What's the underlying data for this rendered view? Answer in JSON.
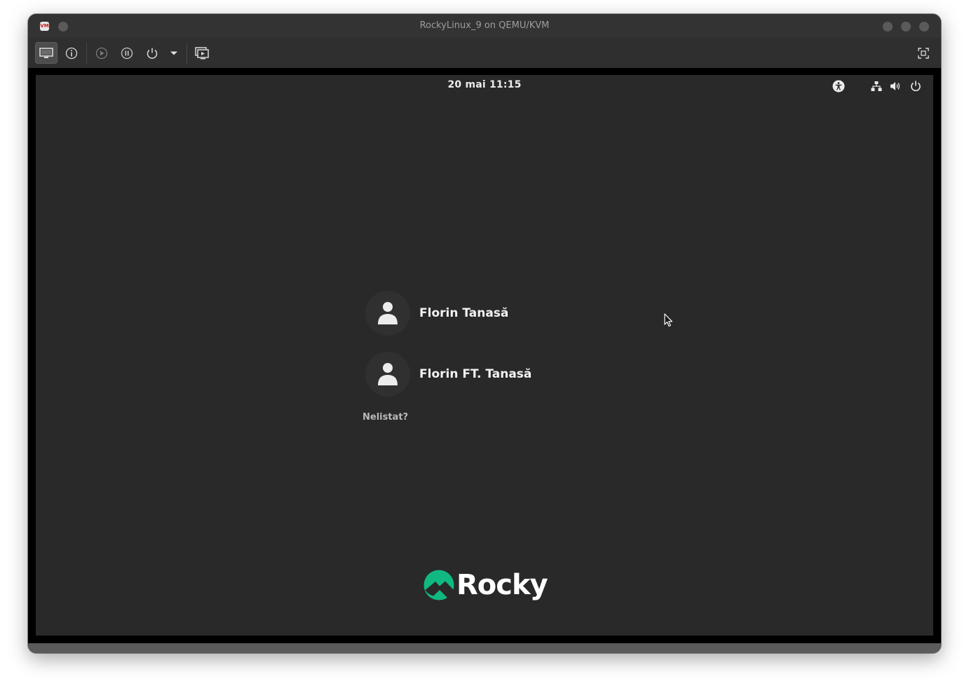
{
  "window": {
    "title": "RockyLinux_9 on QEMU/KVM",
    "app_icon_text": "VM"
  },
  "toolbar": {
    "buttons": [
      {
        "icon": "display-console-icon",
        "active": true
      },
      {
        "icon": "info-icon",
        "active": false
      },
      {
        "icon": "run-icon",
        "active": false
      },
      {
        "icon": "pause-icon",
        "active": false
      },
      {
        "icon": "power-icon",
        "active": false
      },
      {
        "icon": "dropdown-arrow-icon",
        "active": false
      },
      {
        "icon": "snapshots-icon",
        "active": false
      },
      {
        "icon": "fullscreen-icon",
        "active": false
      }
    ]
  },
  "guest": {
    "clock": "20 mai  11:15",
    "tray_icons": [
      "accessibility-icon",
      "network-icon",
      "volume-icon",
      "power-icon"
    ],
    "users": [
      {
        "name": "Florin Tanasă"
      },
      {
        "name": "Florin FT. Tanasă"
      }
    ],
    "not_listed": "Nelistat?",
    "logo_text": "Rocky",
    "brand_color": "#10b981"
  }
}
